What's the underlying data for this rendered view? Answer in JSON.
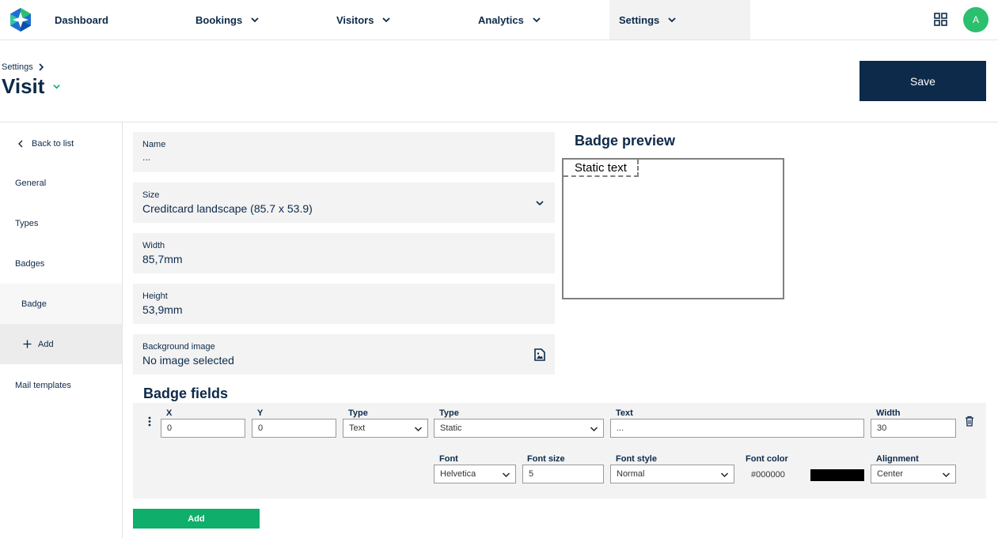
{
  "nav": {
    "items": [
      {
        "label": "Dashboard"
      },
      {
        "label": "Bookings"
      },
      {
        "label": "Visitors"
      },
      {
        "label": "Analytics"
      },
      {
        "label": "Settings"
      }
    ],
    "avatar_initial": "A"
  },
  "header": {
    "breadcrumb": "Settings",
    "title": "Visit",
    "save_label": "Save"
  },
  "sidebar": {
    "back_label": "Back to list",
    "items": [
      {
        "label": "General"
      },
      {
        "label": "Types"
      },
      {
        "label": "Badges"
      },
      {
        "label": "Badge"
      },
      {
        "label": "Add"
      },
      {
        "label": "Mail templates"
      }
    ]
  },
  "form": {
    "name": {
      "label": "Name",
      "value": "..."
    },
    "size": {
      "label": "Size",
      "value": "Creditcard landscape (85.7 x 53.9)"
    },
    "width": {
      "label": "Width",
      "value": "85,7mm"
    },
    "height": {
      "label": "Height",
      "value": "53,9mm"
    },
    "background": {
      "label": "Background image",
      "value": "No image selected"
    }
  },
  "preview": {
    "title": "Badge preview",
    "static_text": "Static text"
  },
  "badge_fields": {
    "title": "Badge fields",
    "row": {
      "x_label": "X",
      "x_value": "0",
      "y_label": "Y",
      "y_value": "0",
      "type_label": "Type",
      "type_value": "Text",
      "type2_label": "Type",
      "type2_value": "Static",
      "text_label": "Text",
      "text_value": "...",
      "width_label": "Width",
      "width_value": "30",
      "font_label": "Font",
      "font_value": "Helvetica",
      "font_size_label": "Font size",
      "font_size_value": "5",
      "font_style_label": "Font style",
      "font_style_value": "Normal",
      "font_color_label": "Font color",
      "font_color_value": "#000000",
      "alignment_label": "Alignment",
      "alignment_value": "Center"
    },
    "add_label": "Add"
  },
  "colors": {
    "navy": "#0d2a4a",
    "green": "#0fae6a",
    "avatar_green": "#2bbf6e"
  }
}
